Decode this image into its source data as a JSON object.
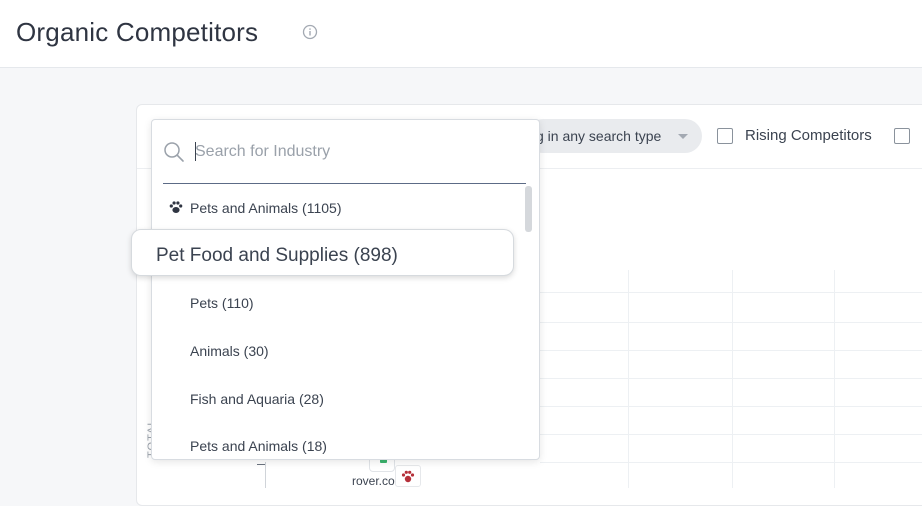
{
  "header": {
    "title": "Organic Competitors"
  },
  "toolbar": {
    "search_type_label": "g in any search type",
    "rising_label": "Rising Competitors"
  },
  "dropdown": {
    "search_placeholder": "Search for Industry",
    "parent_item": "Pets and Animals (1105)",
    "highlighted_item": "Pet Food and Supplies (898)",
    "items": [
      "Pets (110)",
      "Animals (30)",
      "Fish and Aquaria (28)",
      "Pets and Animals (18)"
    ]
  },
  "chart": {
    "y_axis_label": "TOTAL",
    "site_label": "rover.com"
  },
  "colors": {
    "accent_underline": "#5c6b86",
    "bubble_green": "#3cb46e",
    "paw_red": "#b5303a"
  }
}
